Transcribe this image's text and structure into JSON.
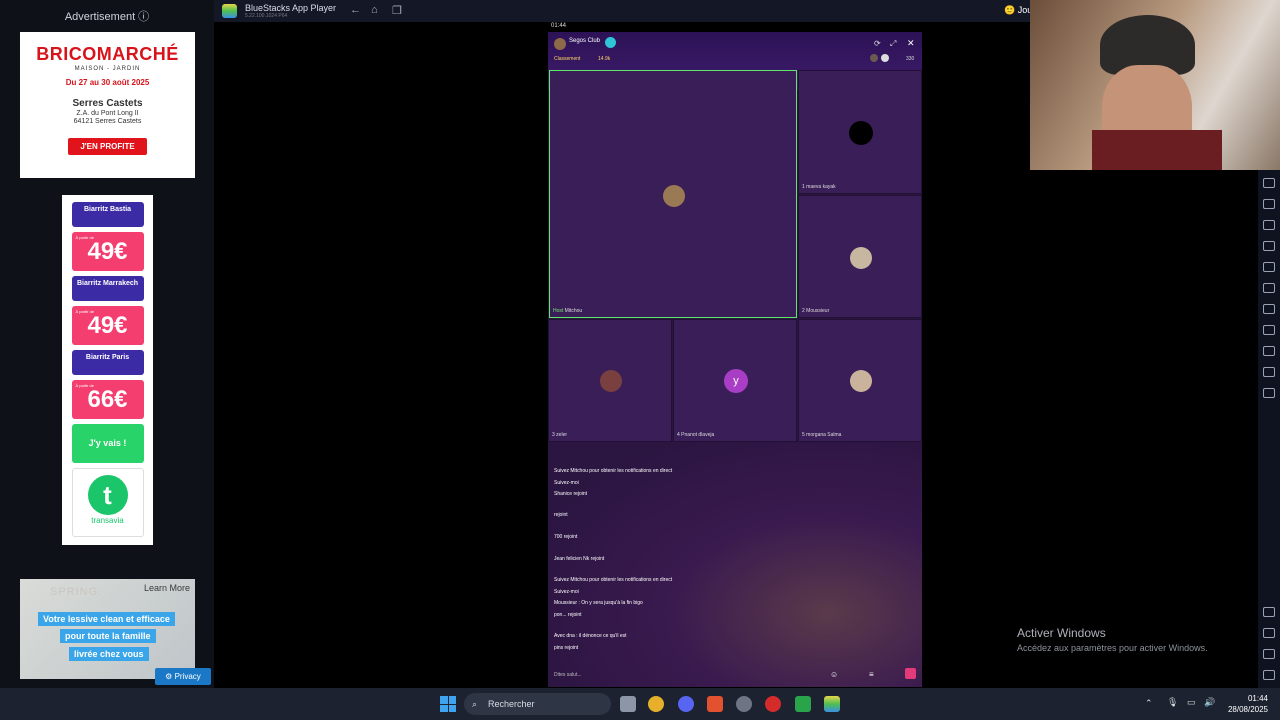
{
  "ads": {
    "title": "Advertisement ⓘ",
    "bricomarche": {
      "logo": "BRICOMARCHÉ",
      "sub": "MAISON - JARDIN",
      "dates": "Du 27 au 30 août 2025",
      "store": "Serres Castets",
      "address1": "Z.A. du Pont Long II",
      "address2": "64121 Serres Castets",
      "cta": "J'EN PROFITE"
    },
    "transavia": {
      "routes": [
        "Biarritz Bastia",
        "Biarritz Marrakech",
        "Biarritz Paris"
      ],
      "prefix": "À partir de",
      "prices": [
        "49€",
        "49€",
        "66€"
      ],
      "cta": "J'y vais !",
      "brand": "transavia",
      "logo_letter": "t"
    },
    "spring": {
      "logo": "SPRING.",
      "learn_more": "Learn More",
      "lines": [
        "Votre lessive clean et efficace",
        "pour toute la famille",
        "livrée chez vous"
      ]
    },
    "privacy": "Privacy"
  },
  "bluestacks": {
    "title": "BlueStacks App Player",
    "version": "5.22.100.1024  P64",
    "games_label": "Jou"
  },
  "phone": {
    "time": "01:44",
    "room_name": "Segos Club",
    "ranking": "Classement",
    "coins": "14.9k",
    "viewers": "330",
    "host_tag": "Host",
    "tiles": [
      {
        "name": "Mitchou",
        "index": ""
      },
      {
        "name": "maeva kayak",
        "index": "1"
      },
      {
        "name": "Moussieur",
        "index": "2"
      },
      {
        "name": "zeler",
        "index": "3"
      },
      {
        "name": "Pnanot dlaveja",
        "index": "4"
      },
      {
        "name": "morgana Salma",
        "index": "5"
      }
    ],
    "y_avatar": "y",
    "chat": [
      "Suivez Mitchou pour obtenir les notifications en direct",
      "Suivez-moi",
      "Shanice rejoint",
      "rejoint",
      "700 rejoint",
      "Jean felicien Nk rejoint",
      "Suivez Mitchou pour obtenir les notifications en direct",
      "Suivez-moi",
      "pon... rejoint",
      "Moussieur : On y sera jusqu'à la fin bigo",
      "Avec dna : il dénonce ce qu'il est",
      "pins rejoint"
    ],
    "input_placeholder": "Dites salut..."
  },
  "windows": {
    "activate_title": "Activer Windows",
    "activate_sub": "Accédez aux paramètres pour activer Windows.",
    "search": "Rechercher",
    "time": "01:44",
    "date": "28/08/2025"
  }
}
